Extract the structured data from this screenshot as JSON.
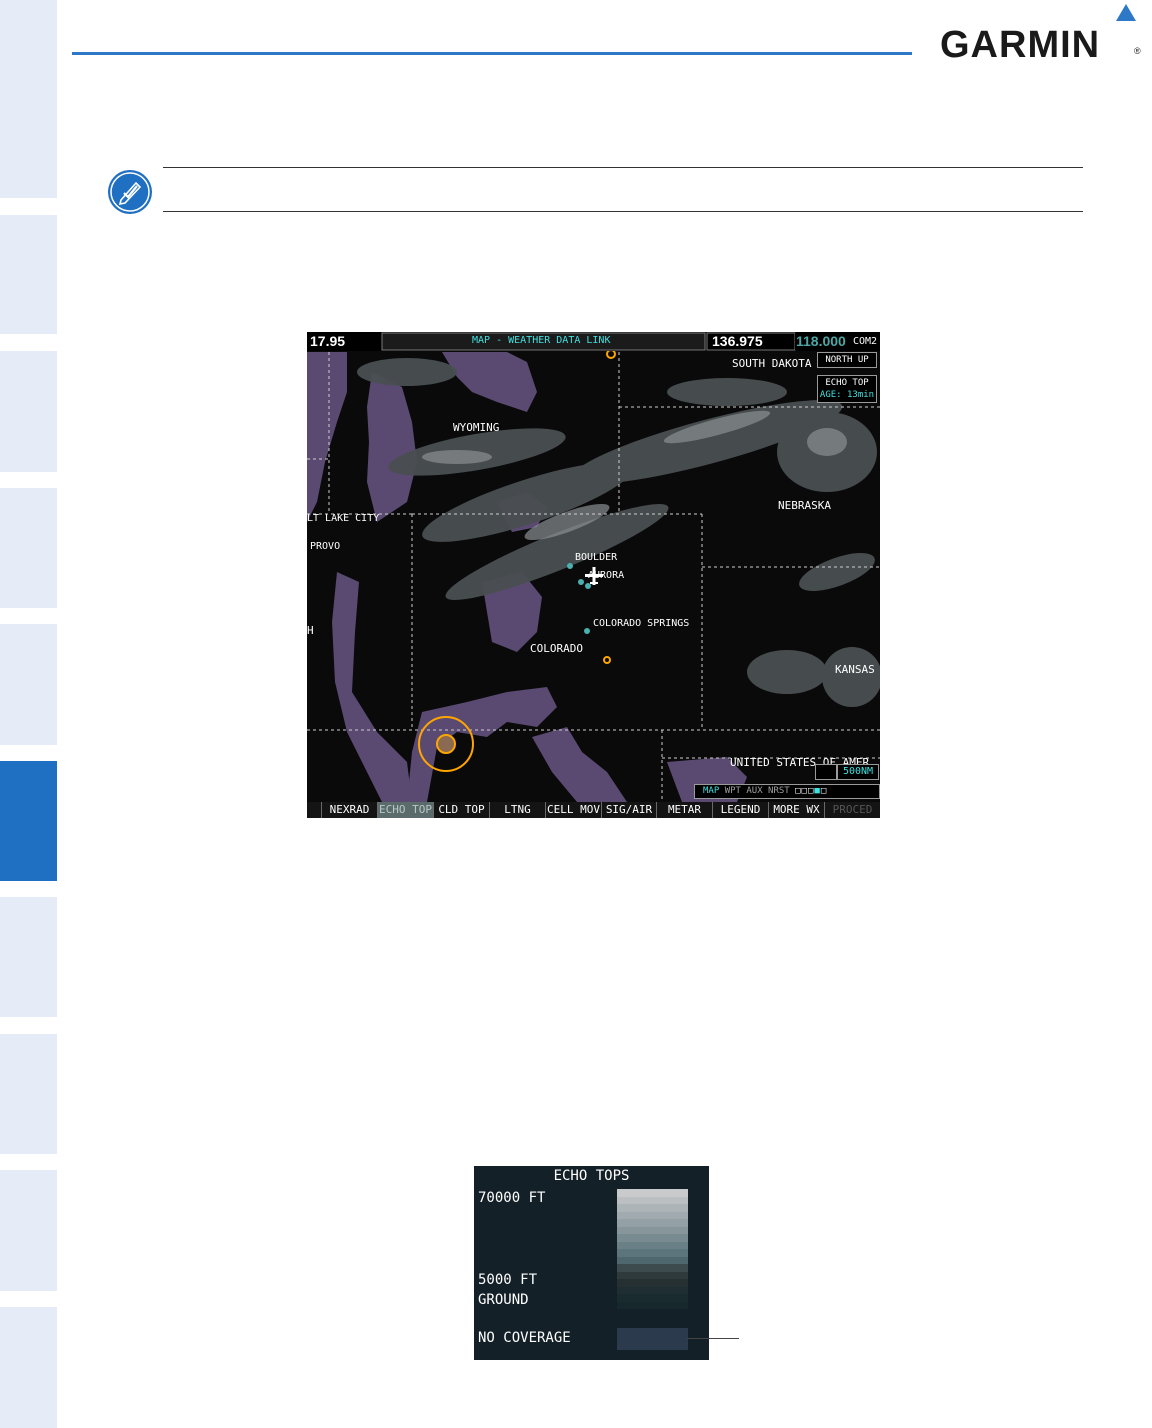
{
  "header": {
    "brand": "GARMIN",
    "registered": "®"
  },
  "mfd": {
    "nav_freq": "17.95",
    "page_title": "MAP - WEATHER DATA LINK",
    "com_active": "136.975",
    "com_standby": "118.000",
    "com_label": "COM2",
    "orientation": "NORTH UP",
    "product": "ECHO TOP",
    "age": "AGE: 13min",
    "range": "500NM",
    "page_group": {
      "current": "MAP",
      "others": "WPT AUX NRST"
    },
    "map_labels": {
      "south_dakota": "SOUTH DAKOTA",
      "wyoming": "WYOMING",
      "nebraska": "NEBRASKA",
      "salt_lake_city": "LT LAKE CITY",
      "provo": "PROVO",
      "boulder": "BOULDER",
      "aurora": "AURORA",
      "colorado_springs": "COLORADO SPRINGS",
      "colorado": "COLORADO",
      "kansas": "KANSAS",
      "edge_h": "H",
      "united_states": "UNITED STATES OF AMER"
    },
    "softkeys": [
      "",
      "NEXRAD",
      "ECHO TOP",
      "CLD TOP",
      "LTNG",
      "CELL MOV",
      "SIG/AIR",
      "METAR",
      "LEGEND",
      "MORE WX",
      "PROCED"
    ]
  },
  "legend": {
    "title": "ECHO TOPS",
    "top_label": "70000 FT",
    "mid_label": "5000 FT",
    "ground_label": "GROUND",
    "no_coverage_label": "NO COVERAGE",
    "scale_colors": [
      "#c8cacb",
      "#bbbfc1",
      "#adb4b7",
      "#a1aaae",
      "#93a0a5",
      "#86969b",
      "#788b91",
      "#6a8087",
      "#5c747b",
      "#4e676f",
      "#3d4a4e",
      "#2f3a3d",
      "#263033",
      "#1e2e33",
      "#1a2b30",
      "#17282d"
    ],
    "no_coverage_color": "#2c3a4d"
  },
  "tabs": {
    "active_index": 5
  }
}
